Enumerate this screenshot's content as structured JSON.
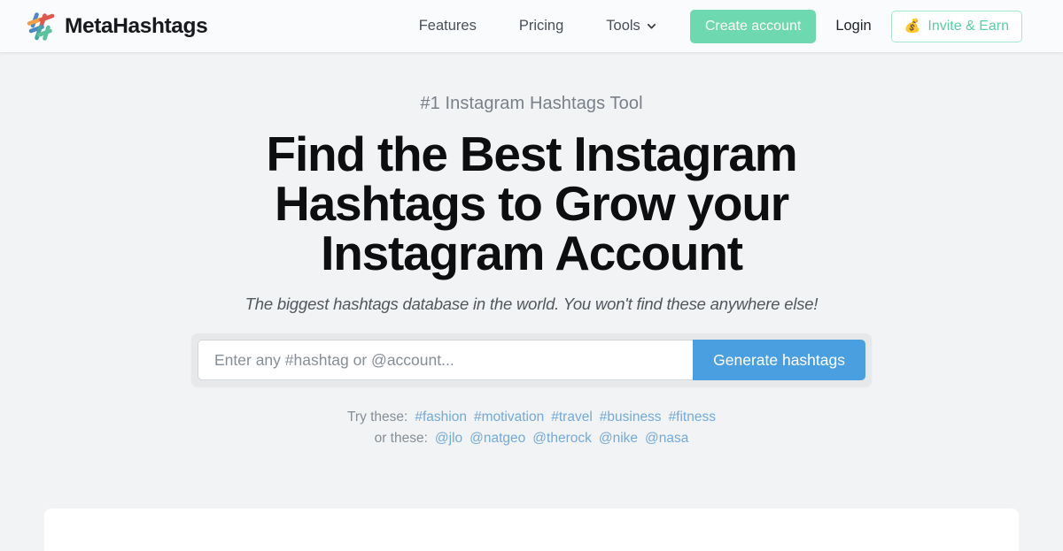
{
  "navbar": {
    "brand": {
      "name": "MetaHashtags",
      "logo_icon": "hashtag-logo-icon"
    },
    "links": [
      {
        "label": "Features",
        "name": "features"
      },
      {
        "label": "Pricing",
        "name": "pricing"
      },
      {
        "label": "Tools",
        "name": "tools",
        "caret": "chevron-down-icon"
      }
    ],
    "create_account_label": "Create account",
    "login_label": "Login",
    "invite_label": "Invite & Earn",
    "invite_emoji": "💰",
    "colors": {
      "create_account_bg": "#6ed8b0",
      "invite_text": "#5ccfa3",
      "invite_border": "#a8e6cd",
      "navbar_bg": "#fafbfc"
    }
  },
  "hero": {
    "eyebrow": "#1 Instagram Hashtags Tool",
    "headline": "Find the Best Instagram Hashtags to Grow your Instagram Account",
    "subhead": "The biggest hashtags database in the world. You won't find these anywhere else!"
  },
  "search": {
    "placeholder": "Enter any #hashtag or @account...",
    "value": "",
    "button_label": "Generate hashtags",
    "button_color": "#4a9fe0"
  },
  "suggestions": {
    "hashtags_label": "Try these:",
    "hashtags": [
      "#fashion",
      "#motivation",
      "#travel",
      "#business",
      "#fitness"
    ],
    "accounts_label": "or these:",
    "accounts": [
      "@jlo",
      "@natgeo",
      "@therock",
      "@nike",
      "@nasa"
    ],
    "link_color": "#74a9d8"
  },
  "page": {
    "background": "#f1f3f5",
    "card_background": "#ffffff"
  }
}
